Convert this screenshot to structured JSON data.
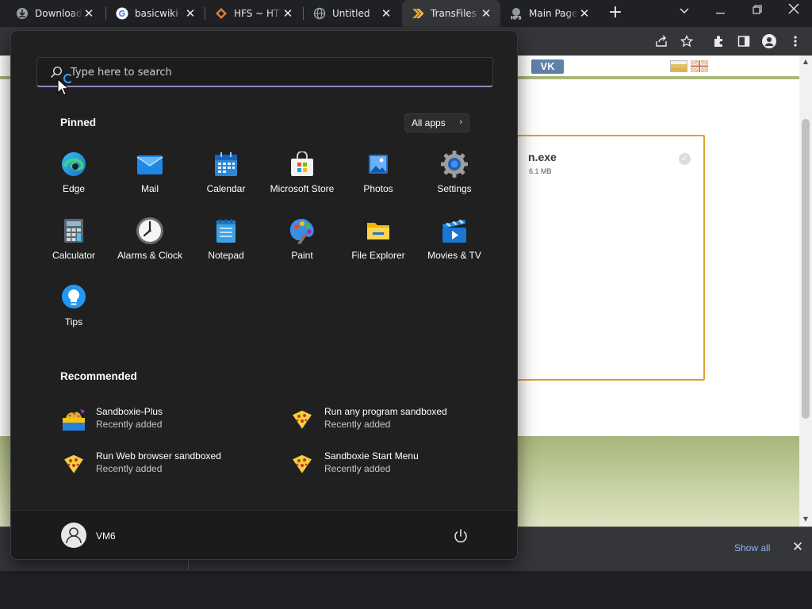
{
  "browser": {
    "tabs": [
      {
        "title": "Downloads",
        "favicon": "downloads-icon"
      },
      {
        "title": "basicwiki - G",
        "favicon": "google-icon"
      },
      {
        "title": "HFS ~ HTTP",
        "favicon": "hfs-icon"
      },
      {
        "title": "Untitled",
        "favicon": "globe-icon"
      },
      {
        "title": "TransFiles - ",
        "favicon": "transfiles-icon",
        "active": true
      },
      {
        "title": "Main Page",
        "favicon": "hfs-logo-icon"
      }
    ],
    "window_controls": [
      "tab-search-icon",
      "minimize-icon",
      "restore-icon",
      "close-icon"
    ],
    "toolbar_icons": [
      "share-icon",
      "star-icon",
      "extensions-icon",
      "side-panel-icon",
      "profile-icon",
      "menu-icon"
    ]
  },
  "webpage": {
    "vk_button": "VK",
    "file_card": {
      "name": "n.exe",
      "size": "6.1 MB"
    },
    "colors": {
      "card_border": "#e0a030",
      "band": "#a8b878"
    }
  },
  "start_menu": {
    "search_placeholder": "Type here to search",
    "pinned_title": "Pinned",
    "all_apps_label": "All apps",
    "pinned": [
      {
        "label": "Edge",
        "icon": "edge-icon"
      },
      {
        "label": "Mail",
        "icon": "mail-icon"
      },
      {
        "label": "Calendar",
        "icon": "calendar-icon"
      },
      {
        "label": "Microsoft Store",
        "icon": "store-icon"
      },
      {
        "label": "Photos",
        "icon": "photos-icon"
      },
      {
        "label": "Settings",
        "icon": "settings-icon"
      },
      {
        "label": "Calculator",
        "icon": "calculator-icon"
      },
      {
        "label": "Alarms & Clock",
        "icon": "clock-icon"
      },
      {
        "label": "Notepad",
        "icon": "notepad-icon"
      },
      {
        "label": "Paint",
        "icon": "paint-icon"
      },
      {
        "label": "File Explorer",
        "icon": "folder-icon"
      },
      {
        "label": "Movies & TV",
        "icon": "movies-icon"
      },
      {
        "label": "Tips",
        "icon": "tips-icon"
      }
    ],
    "recommended_title": "Recommended",
    "recommended": [
      {
        "name": "Sandboxie-Plus",
        "sub": "Recently added",
        "icon": "sandboxie-plus-icon"
      },
      {
        "name": "Run any program sandboxed",
        "sub": "Recently added",
        "icon": "sandboxie-icon"
      },
      {
        "name": "Run Web browser sandboxed",
        "sub": "Recently added",
        "icon": "sandboxie-icon"
      },
      {
        "name": "Sandboxie Start Menu",
        "sub": "Recently added",
        "icon": "sandboxie-icon"
      }
    ],
    "user_name": "VM6"
  },
  "download_shelf": {
    "show_all": "Show all"
  }
}
